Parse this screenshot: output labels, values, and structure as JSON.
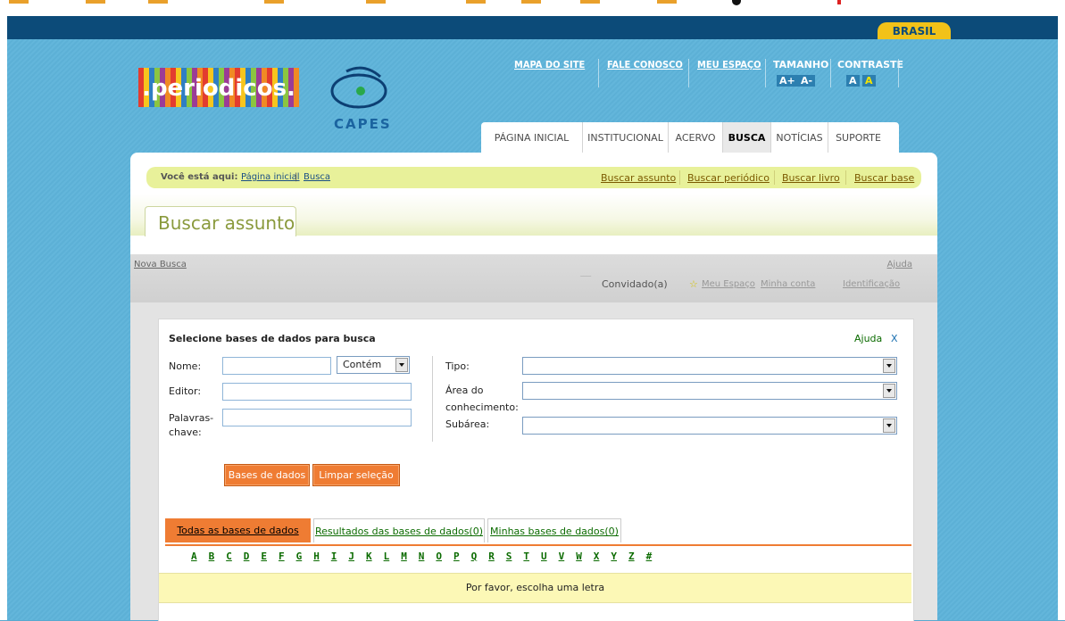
{
  "gov": {
    "brasil_label": "BRASIL"
  },
  "logo": {
    "periodicos": ".periodicos.",
    "capes": "CAPES"
  },
  "toplinks": {
    "mapa": "MAPA DO SITE",
    "fale": "FALE CONOSCO",
    "meu_espaco": "MEU ESPAÇO",
    "tamanho": "TAMANHO",
    "tam_mais": "A+",
    "tam_menos": "A-",
    "contraste": "CONTRASTE",
    "contraste_a1": "A",
    "contraste_a2": "A"
  },
  "tabs": [
    "PÁGINA INICIAL",
    "INSTITUCIONAL",
    "ACERVO",
    "BUSCA",
    "NOTÍCIAS",
    "SUPORTE"
  ],
  "active_tab": "BUSCA",
  "breadcrumb": {
    "prefix": "Você está aqui:",
    "home": "Página inicial",
    "sep": "|",
    "current": "Busca",
    "quick_links": [
      "Buscar assunto",
      "Buscar periódico",
      "Buscar livro",
      "Buscar base"
    ]
  },
  "page_title": "Buscar assunto",
  "toolbar": {
    "nova_busca": "Nova Busca",
    "ajuda": "Ajuda",
    "convidado": "Convidado(a)",
    "meu_espaco": "Meu Espaço",
    "minha_conta": "Minha conta",
    "identificacao": "Identificação"
  },
  "search": {
    "heading": "Selecione bases de dados para busca",
    "ajuda": "Ajuda",
    "close": "X",
    "nome_label": "Nome:",
    "nome_value": "",
    "nome_mode": "Contém",
    "editor_label": "Editor:",
    "editor_value": "",
    "palavras_label_1": "Palavras-",
    "palavras_label_2": "chave:",
    "palavras_value": "",
    "tipo_label": "Tipo:",
    "tipo_value": "",
    "area_label_1": "Área do",
    "area_label_2": "conhecimento:",
    "area_value": "",
    "subarea_label": "Subárea:",
    "subarea_value": "",
    "btn_bases": "Bases de dados",
    "btn_limpar": "Limpar seleção"
  },
  "result_tabs": [
    "Todas as bases de dados",
    "Resultados das bases de dados(0)",
    "Minhas bases de dados(0)"
  ],
  "letters": [
    "A",
    "B",
    "C",
    "D",
    "E",
    "F",
    "G",
    "H",
    "I",
    "J",
    "K",
    "L",
    "M",
    "N",
    "O",
    "P",
    "Q",
    "R",
    "S",
    "T",
    "U",
    "V",
    "W",
    "X",
    "Y",
    "Z",
    "#"
  ],
  "message": "Por favor, escolha uma letra",
  "colors": {
    "accent": "#ef7c33",
    "gov_bar": "#0c4b79",
    "brasil": "#f2c218",
    "crumb": "#e8f19a",
    "link_green": "#0b6b00"
  }
}
